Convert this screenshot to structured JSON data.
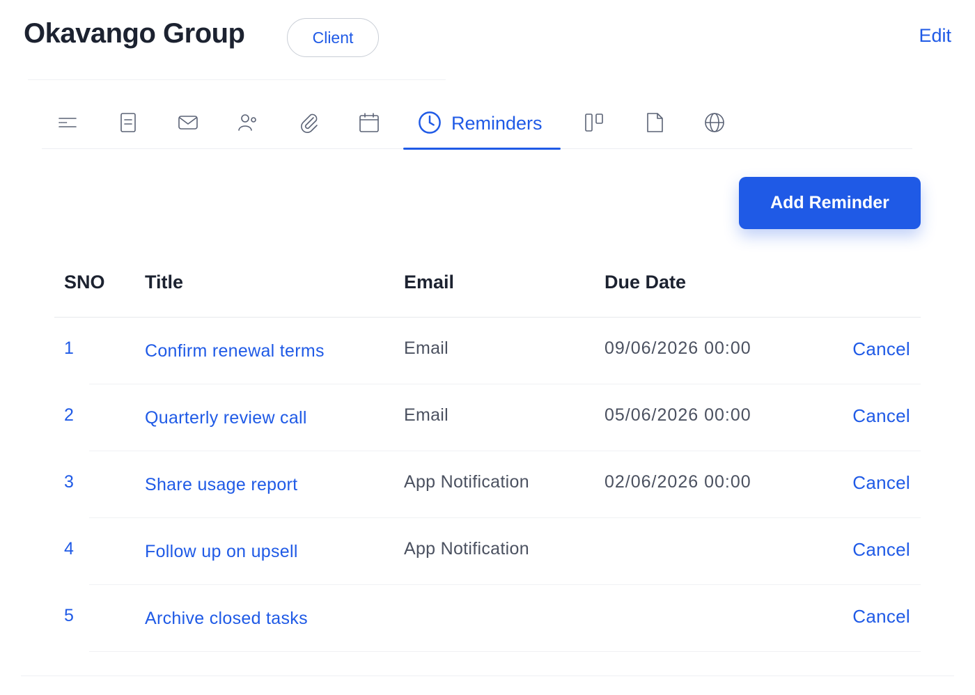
{
  "header": {
    "company": "Okavango Group",
    "badge": "Client",
    "edit": "Edit"
  },
  "tabs": {
    "icons": [
      "menu-lines-icon",
      "document-icon",
      "mail-icon",
      "people-icon",
      "paperclip-icon",
      "calendar-icon",
      "clock-icon",
      "kanban-icon",
      "file-icon",
      "globe-icon"
    ],
    "active_label": "Reminders"
  },
  "actions": {
    "add": "Add Reminder"
  },
  "table": {
    "headers": [
      "SNO",
      "Title",
      "Email",
      "Due Date"
    ],
    "rows": [
      {
        "sno": "1",
        "title": "Confirm renewal terms",
        "channel": "Email",
        "due": "09/06/2026 00:00",
        "action": "Cancel"
      },
      {
        "sno": "2",
        "title": "Quarterly review call",
        "channel": "Email",
        "due": "05/06/2026 00:00",
        "action": "Cancel"
      },
      {
        "sno": "3",
        "title": "Share usage report",
        "channel": "App Notification",
        "due": "02/06/2026 00:00",
        "action": "Cancel"
      },
      {
        "sno": "4",
        "title": "Follow up on upsell",
        "channel": "App Notification",
        "due": "",
        "action": "Cancel"
      },
      {
        "sno": "5",
        "title": "Archive closed tasks",
        "channel": "",
        "due": "",
        "action": "Cancel"
      }
    ]
  },
  "colors": {
    "accent": "#1f5ae6",
    "text": "#1c2230",
    "muted": "#4b5160",
    "icon": "#5a6275"
  }
}
